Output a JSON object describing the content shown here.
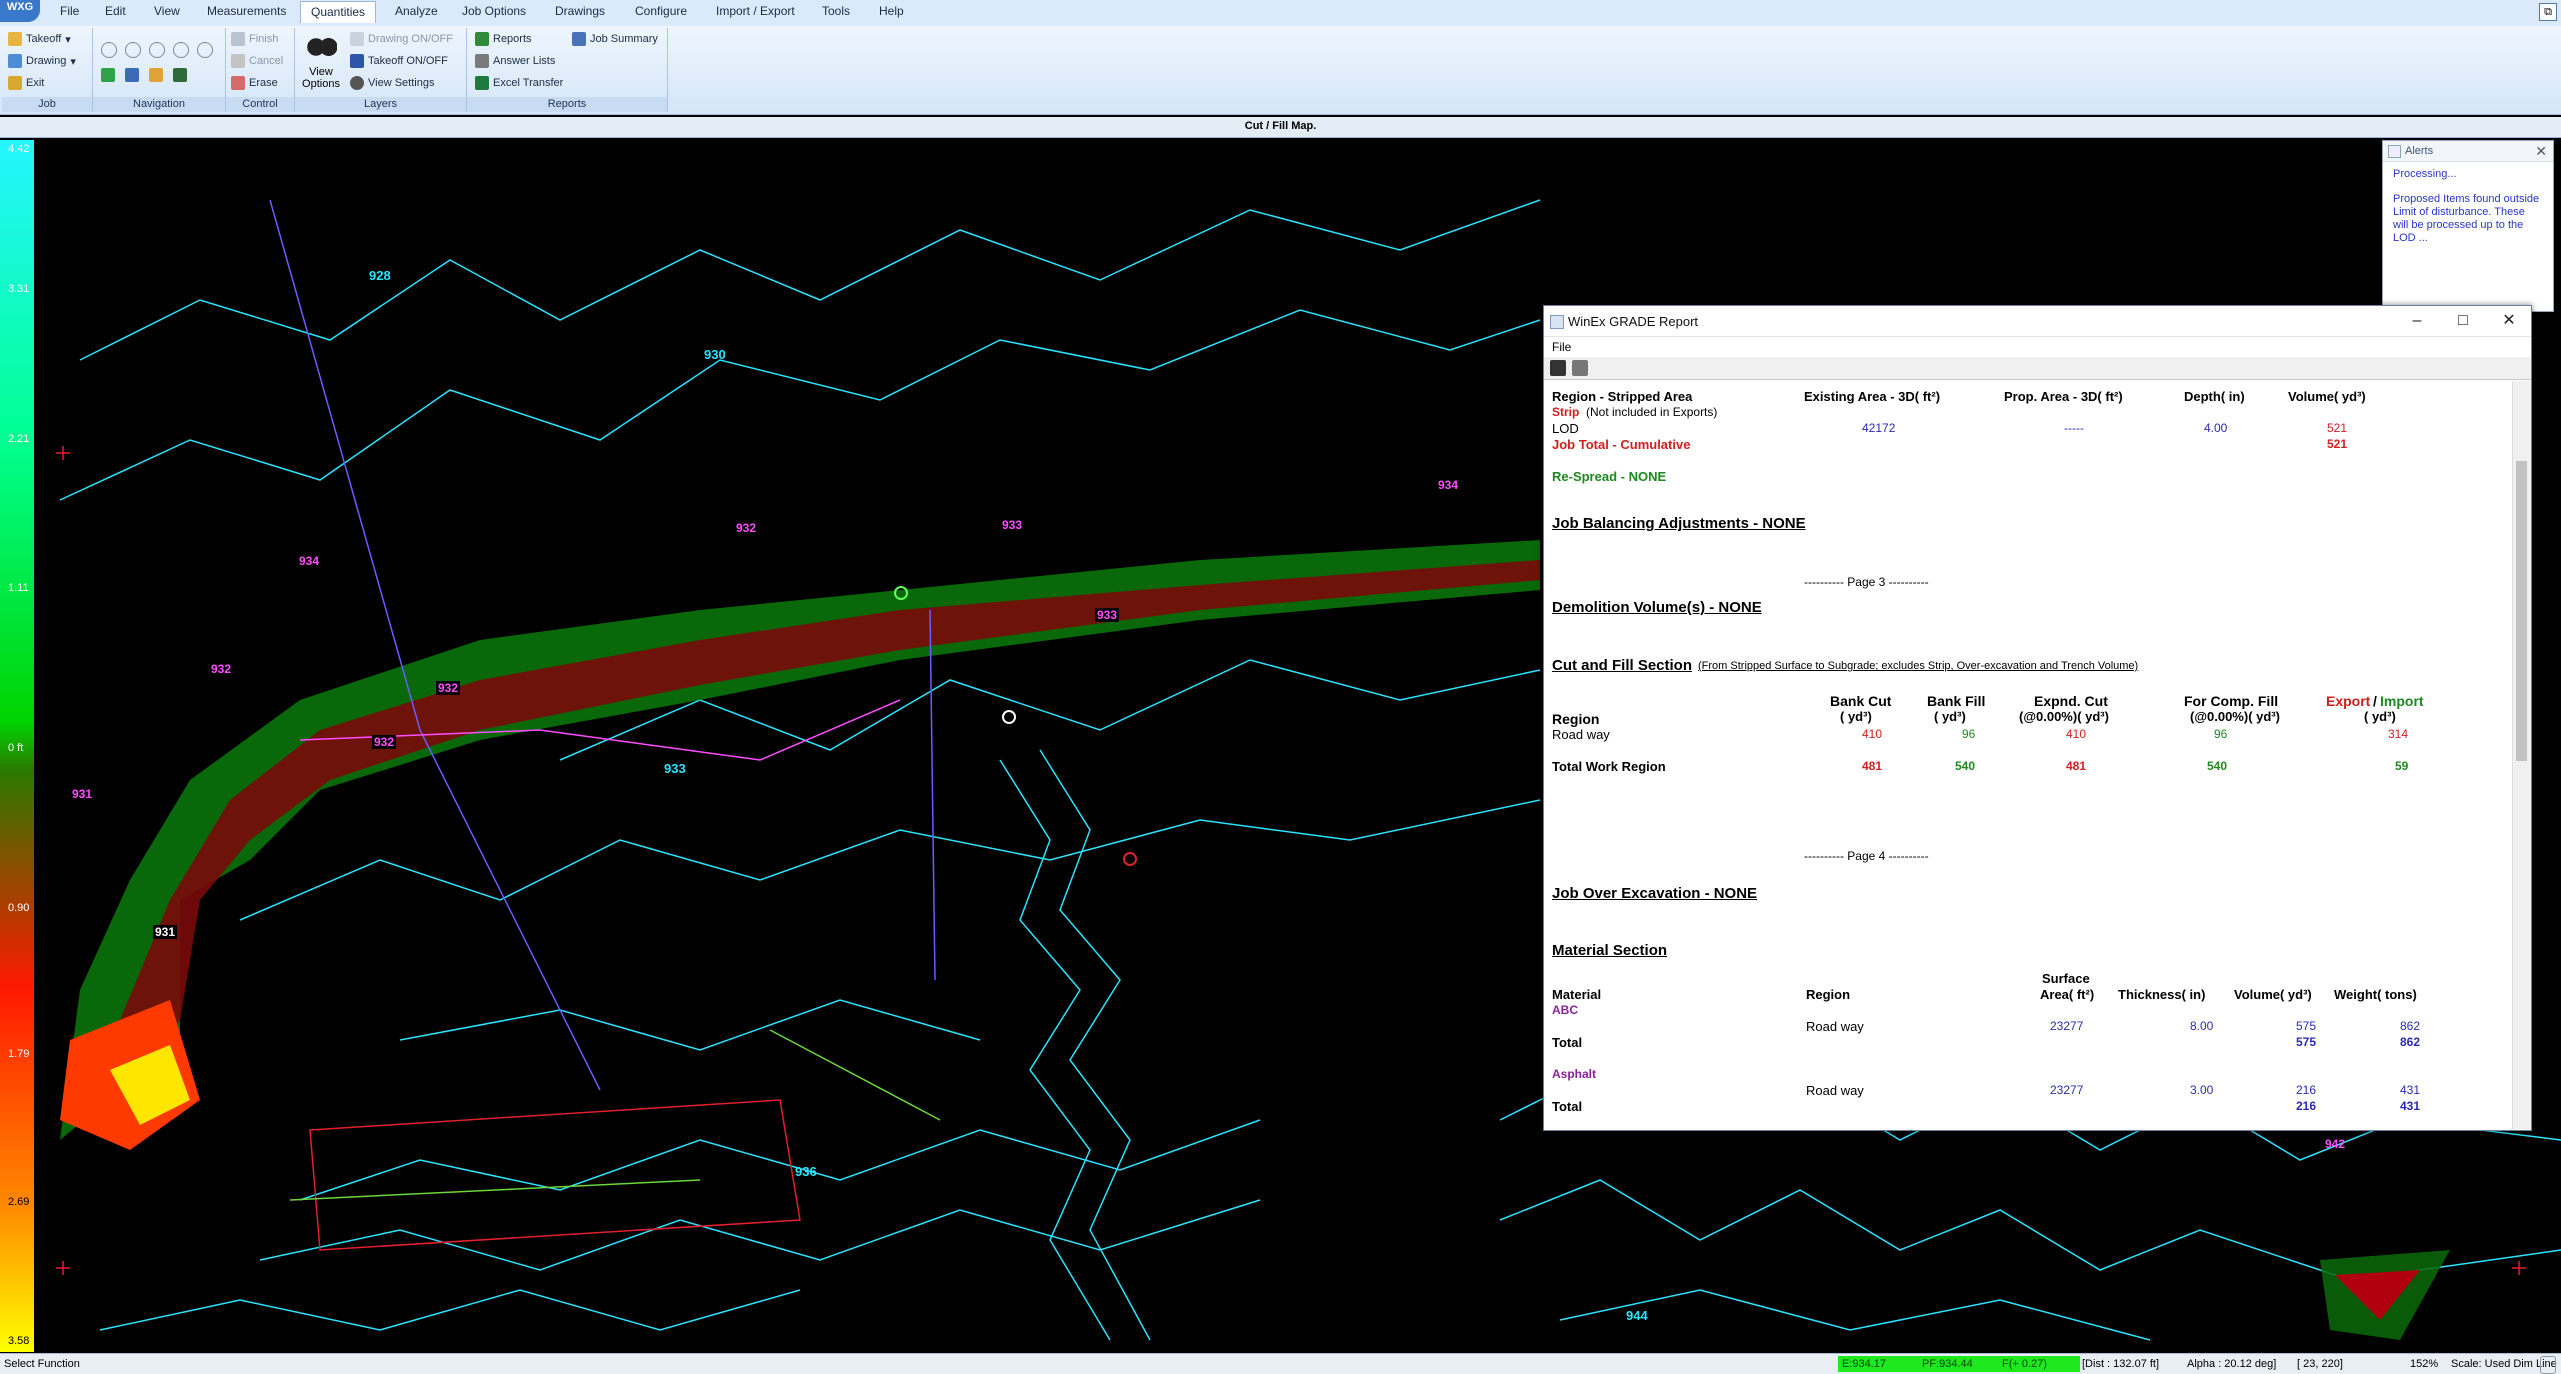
{
  "app": {
    "logo": "WXG"
  },
  "menu": [
    "File",
    "Edit",
    "View",
    "Measurements",
    "Quantities",
    "Analyze",
    "Job Options",
    "Drawings",
    "Configure",
    "Import / Export",
    "Tools",
    "Help"
  ],
  "menu_active": "Quantities",
  "ribbon": {
    "job": {
      "takeoff": "Takeoff",
      "drawing": "Drawing",
      "exit": "Exit",
      "group": "Job"
    },
    "navigation": {
      "group": "Navigation"
    },
    "control": {
      "finish": "Finish",
      "cancel": "Cancel",
      "erase": "Erase",
      "group": "Control"
    },
    "layers": {
      "view_options": "View Options",
      "drawing_onoff": "Drawing ON/OFF",
      "takeoff_onoff": "Takeoff ON/OFF",
      "view_settings": "View Settings",
      "group": "Layers"
    },
    "reports": {
      "reports": "Reports",
      "job_summary": "Job Summary",
      "answer_lists": "Answer Lists",
      "excel_transfer": "Excel Transfer",
      "group": "Reports"
    }
  },
  "doc_title": "Cut / Fill Map.",
  "legend": [
    "4.42",
    "3.31",
    "2.21",
    "1.11",
    "0 ft",
    "0.90",
    "1.79",
    "2.69",
    "3.58"
  ],
  "map_labels": {
    "contours": [
      "928",
      "930",
      "933",
      "936",
      "944"
    ],
    "proposed": [
      "934",
      "932",
      "933",
      "934",
      "932",
      "932",
      "933",
      "932",
      "931",
      "931",
      "942"
    ]
  },
  "alerts": {
    "title": "Alerts",
    "line1": "Processing...",
    "line2": "Proposed Items found outside Limit of disturbance. These will be processed up to the LOD ..."
  },
  "report": {
    "title": "WinEx GRADE Report",
    "menu_file": "File",
    "stripped": {
      "h_region": "Region - Stripped Area",
      "h_existing": "Existing Area - 3D( ft²)",
      "h_prop": "Prop. Area - 3D( ft²)",
      "h_depth": "Depth( in)",
      "h_volume": "Volume( yd³)",
      "strip": "Strip",
      "strip_note": "(Not included in Exports)",
      "lod": "LOD",
      "lod_existing": "42172",
      "lod_prop": "-----",
      "lod_depth": "4.00",
      "lod_volume": "521",
      "job_total": "Job Total - Cumulative",
      "job_total_volume": "521",
      "respread": "Re-Spread - NONE"
    },
    "balancing": "Job Balancing Adjustments - NONE",
    "page3": "---------- Page 3 ----------",
    "demolition": "Demolition Volume(s) - NONE",
    "cutfill": {
      "title": "Cut and Fill Section",
      "subtitle": "(From Stripped Surface to Subgrade; excludes Strip, Over-excavation and Trench Volume)",
      "h_region": "Region",
      "h_bankcut": "Bank Cut",
      "h_bankcut_u": "( yd³)",
      "h_bankfill": "Bank Fill",
      "h_bankfill_u": "( yd³)",
      "h_expnd": "Expnd. Cut",
      "h_expnd_u": "(@0.00%)( yd³)",
      "h_comp": "For Comp. Fill",
      "h_comp_u": "(@0.00%)( yd³)",
      "h_export": "Export",
      "h_slash": "/",
      "h_import": "Import",
      "h_export_u": "( yd³)",
      "rows": [
        {
          "region": "Road way",
          "bankcut": "410",
          "bankfill": "96",
          "expnd": "410",
          "comp": "96",
          "export": "314"
        },
        {
          "region": "Total Work Region",
          "bankcut": "481",
          "bankfill": "540",
          "expnd": "481",
          "comp": "540",
          "export": "59"
        }
      ]
    },
    "page4": "---------- Page 4 ----------",
    "overexc": "Job Over Excavation - NONE",
    "material": {
      "title": "Material Section",
      "h_material": "Material",
      "h_region": "Region",
      "h_surface1": "Surface",
      "h_surface2": "Area( ft²)",
      "h_thick": "Thickness( in)",
      "h_volume": "Volume( yd³)",
      "h_weight": "Weight( tons)",
      "abc": "ABC",
      "abc_region": "Road way",
      "abc_area": "23277",
      "abc_thick": "8.00",
      "abc_vol": "575",
      "abc_weight": "862",
      "total": "Total",
      "abc_total_vol": "575",
      "abc_total_weight": "862",
      "asphalt": "Asphalt",
      "asp_region": "Road way",
      "asp_area": "23277",
      "asp_thick": "3.00",
      "asp_vol": "216",
      "asp_weight": "431",
      "asp_total": "Total",
      "asp_total_vol": "216",
      "asp_total_weight": "431"
    }
  },
  "status": {
    "left": "Select Function",
    "e": "E:934.17",
    "pf": "PF:934.44",
    "fp": "F(+ 0.27)",
    "dist": "[Dist :   132.07 ft]",
    "alpha": "Alpha : 20.12 deg]",
    "coord": "[ 23, 220]",
    "zoom": "152%",
    "scale": "Scale: Used Dim Line"
  },
  "colors": {
    "ribbon": "#d5e6f8",
    "cut": "#ff1800",
    "fill": "#00d400",
    "contour": "#28e6ff",
    "proposed": "#ff4dff"
  }
}
